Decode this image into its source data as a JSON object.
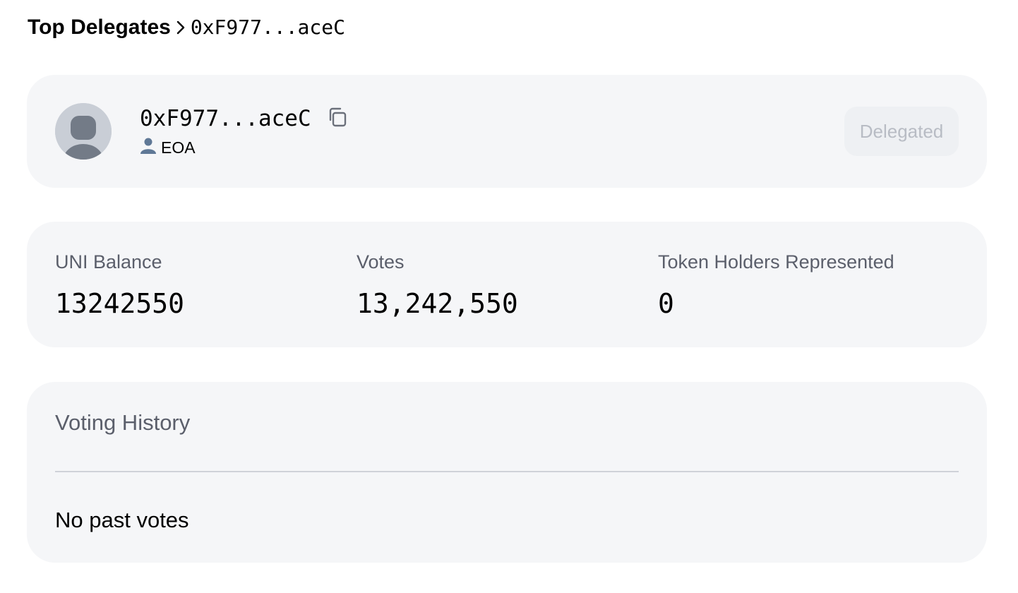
{
  "breadcrumb": {
    "parent": "Top Delegates",
    "separator_icon": "chevron-right-icon",
    "current": "0xF977...aceC"
  },
  "profile": {
    "avatar_icon": "default-avatar-icon",
    "address": "0xF977...aceC",
    "copy_icon": "copy-icon",
    "type_icon": "user-icon",
    "type_label": "EOA",
    "action_button": "Delegated"
  },
  "stats": [
    {
      "label": "UNI Balance",
      "value": "13242550"
    },
    {
      "label": "Votes",
      "value": "13,242,550"
    },
    {
      "label": "Token Holders Represented",
      "value": "0"
    }
  ],
  "history": {
    "title": "Voting History",
    "empty_text": "No past votes"
  },
  "colors": {
    "card_bg": "#f5f6f8",
    "muted_text": "#5b5f6b",
    "disabled_button_text": "#b8bcc4",
    "avatar_bg": "#c9ced6"
  }
}
